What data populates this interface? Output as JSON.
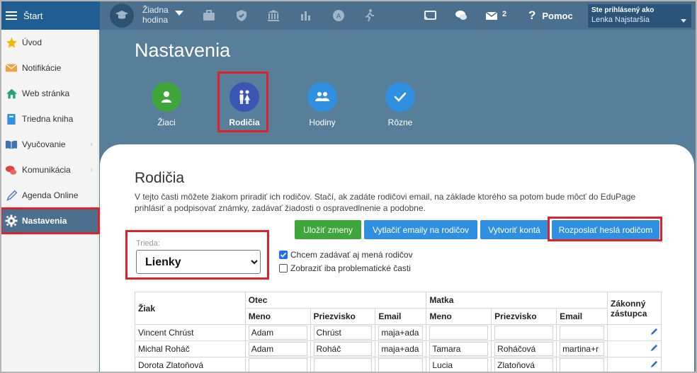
{
  "topbar": {
    "start_label": "Štart",
    "hodina_line1": "Žiadna",
    "hodina_line2": "hodina",
    "messages_count": "2",
    "help_label": "Pomoc",
    "logged_in_label": "Ste prihlásený ako",
    "user_name": "Lenka Najstaršia"
  },
  "sidebar": {
    "items": [
      {
        "label": "Úvod",
        "icon": "star-icon"
      },
      {
        "label": "Notifikácie",
        "icon": "envelope-icon"
      },
      {
        "label": "Web stránka",
        "icon": "home-icon"
      },
      {
        "label": "Triedna kniha",
        "icon": "book-icon"
      },
      {
        "label": "Vyučovanie",
        "icon": "open-book-icon"
      },
      {
        "label": "Komunikácia",
        "icon": "chat-icon"
      },
      {
        "label": "Agenda Online",
        "icon": "pen-icon"
      },
      {
        "label": "Nastavenia",
        "icon": "gear-icon"
      }
    ]
  },
  "page": {
    "title": "Nastavenia",
    "tabs": [
      {
        "label": "Žiaci"
      },
      {
        "label": "Rodičia"
      },
      {
        "label": "Hodiny"
      },
      {
        "label": "Rôzne"
      }
    ]
  },
  "section": {
    "title": "Rodičia",
    "description": "V tejto časti môžete žiakom priradiť ich rodičov. Stačí, ak zadáte rodičovi email, na základe ktorého sa potom bude môcť do EduPage prihlásiť a podpisovať známky, zadávať žiadosti o ospravedlnenie a podobne."
  },
  "buttons": {
    "save": "Uložiť zmeny",
    "print_emails": "Vytlačiť emaily na rodičov",
    "create_accounts": "Vytvoriť kontá",
    "send_passwords": "Rozposlať heslá rodičom"
  },
  "filter": {
    "class_label": "Trieda:",
    "class_value": "Lienky",
    "checkbox_names_label": "Chcem zadávať aj mená rodičov",
    "checkbox_names_checked": true,
    "checkbox_problem_label": "Zobraziť iba problematické časti",
    "checkbox_problem_checked": false
  },
  "table": {
    "col_student": "Žiak",
    "group_father": "Otec",
    "group_mother": "Matka",
    "col_guardian_line1": "Zákonný",
    "col_guardian_line2": "zástupca",
    "col_first_name": "Meno",
    "col_last_name": "Priezvisko",
    "col_email": "Email",
    "rows": [
      {
        "student": "Vincent Chrúst",
        "f_first": "Adam",
        "f_last": "Chrúst",
        "f_email": "maja+ada",
        "m_first": "",
        "m_last": "",
        "m_email": ""
      },
      {
        "student": "Michal Roháč",
        "f_first": "Adam",
        "f_last": "Roháč",
        "f_email": "maja+ada",
        "m_first": "Tamara",
        "m_last": "Roháčová",
        "m_email": "martina+r"
      },
      {
        "student": "Dorota Zlatoňová",
        "f_first": "",
        "f_last": "",
        "f_email": "",
        "m_first": "Lucia",
        "m_last": "Zlatoňová",
        "m_email": ""
      }
    ]
  },
  "colors": {
    "topbar": "#1f5d93",
    "header_bg": "#587f99",
    "tab_green": "#3ea63a",
    "tab_active": "#3b55b5",
    "tab_blue": "#2f8fe0",
    "btn_green": "#3ea63a",
    "btn_blue": "#2f8fe0",
    "highlight": "#e0202b"
  }
}
